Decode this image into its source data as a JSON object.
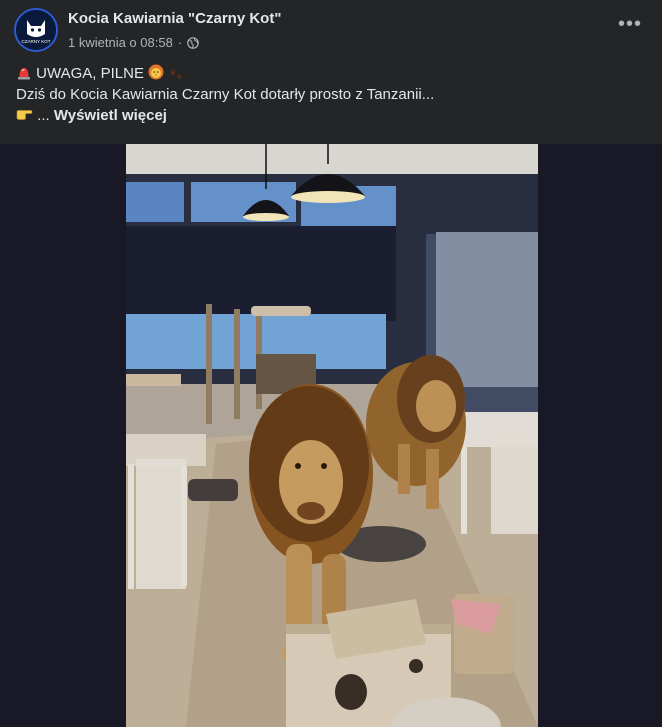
{
  "post": {
    "page_name": "Kocia Kawiarnia \"Czarny Kot\"",
    "avatar_text": "CZARNY KOT",
    "timestamp": "1 kwietnia o 08:58",
    "separator": "·",
    "more_label": "•••",
    "lines": {
      "line1": "UWAGA, PILNE",
      "line2": "Dziś do Kocia Kawiarnia Czarny Kot dotarły prosto z Tanzanii...",
      "line3_prefix": "...",
      "see_more": "Wyświetl więcej"
    }
  },
  "icons": {
    "avatar": "black-cat-logo",
    "privacy": "globe-icon",
    "more": "more-options-icon",
    "siren": "siren-emoji",
    "lion": "lion-face-emoji",
    "paw": "paw-prints-emoji",
    "pointing": "pointing-right-emoji"
  },
  "colors": {
    "background": "#242526",
    "text_primary": "#e4e6eb",
    "text_secondary": "#b0b3b8",
    "media_background": "#181827"
  },
  "media": {
    "description_alt": "Dwa lwy w kawiarni dla kotów"
  }
}
